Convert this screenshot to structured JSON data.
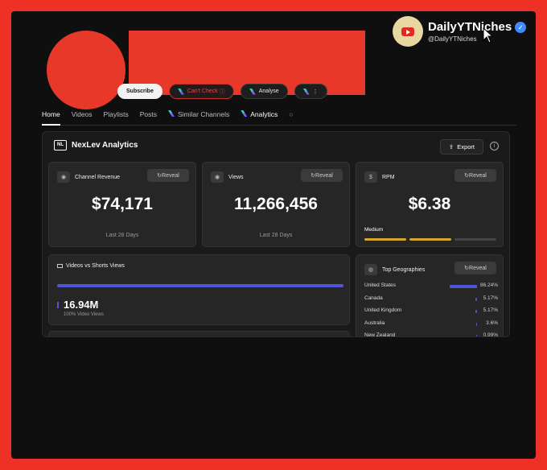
{
  "creator": {
    "name": "DailyYTNiches",
    "handle": "@DailyYTNiches"
  },
  "channel_buttons": {
    "subscribe": "Subscribe",
    "cant_check": "Can't Check",
    "analyse": "Analyse",
    "more": "⋮"
  },
  "tabs": [
    "Home",
    "Videos",
    "Playlists",
    "Posts",
    "Similar Channels",
    "Analytics"
  ],
  "analytics": {
    "title": "NexLev Analytics",
    "export_label": "Export",
    "revenue": {
      "label": "Channel Revenue",
      "value": "$74,171",
      "period": "Last 28 Days",
      "reveal": "Reveal"
    },
    "views": {
      "label": "Views",
      "value": "11,266,456",
      "period": "Last 28 Days",
      "reveal": "Reveal"
    },
    "rpm": {
      "label": "RPM",
      "value": "$6.38",
      "level": "Medium",
      "level_segments_filled": 2,
      "level_segments_total": 3,
      "reveal": "Reveal"
    },
    "videos_vs_shorts": {
      "label": "Videos vs Shorts Views",
      "value": "16.94M",
      "note": "100% Video Views",
      "video_share": 100
    },
    "geographies": {
      "label": "Top Geographies",
      "reveal": "Reveal",
      "rows": [
        {
          "country": "United States",
          "pct": "86.24%",
          "share": 86.24
        },
        {
          "country": "Canada",
          "pct": "5.17%",
          "share": 5.17
        },
        {
          "country": "United Kingdom",
          "pct": "5.17%",
          "share": 5.17
        },
        {
          "country": "Australia",
          "pct": "3.6%",
          "share": 3.6
        },
        {
          "country": "New Zealand",
          "pct": "0.99%",
          "share": 0.99
        }
      ]
    }
  },
  "colors": {
    "background": "#ee3124",
    "accent": "#5155d8",
    "rpm_medium": "#d4a72c"
  }
}
